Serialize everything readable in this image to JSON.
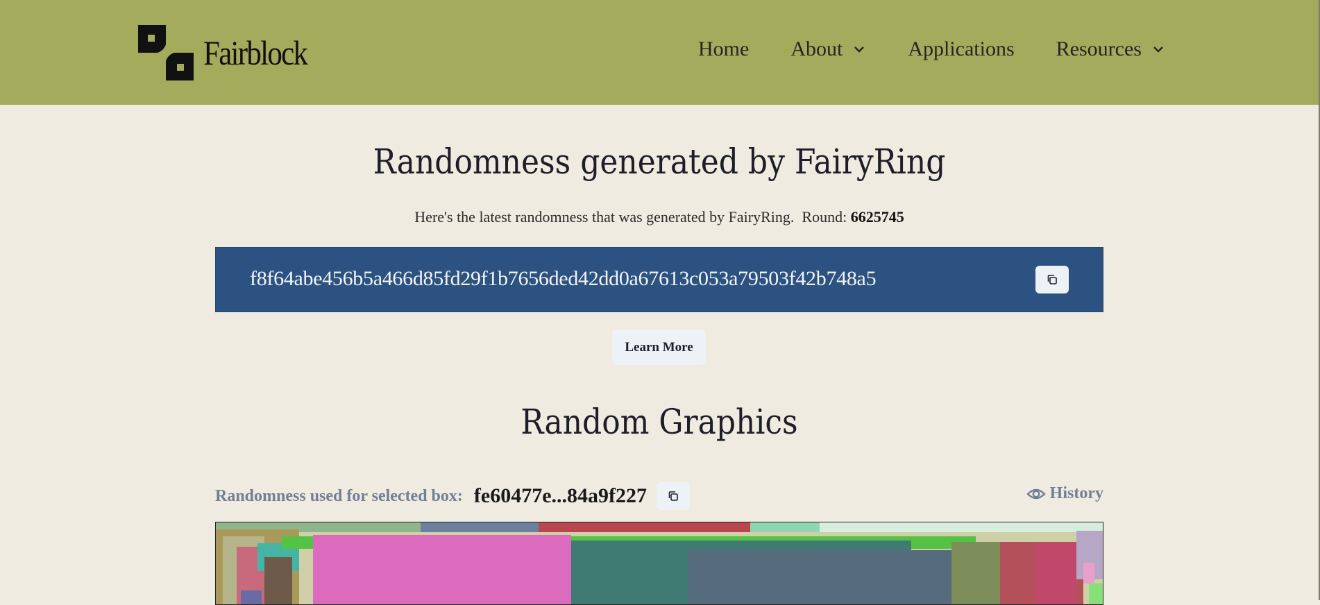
{
  "header": {
    "brand": "Fairblock",
    "nav": {
      "home": "Home",
      "about": "About",
      "applications": "Applications",
      "resources": "Resources"
    }
  },
  "hero": {
    "title": "Randomness generated by FairyRing",
    "subtitle": "Here's the latest randomness that was generated by FairyRing.",
    "round_label": "Round:",
    "round_value": "6625745",
    "randomness": "f8f64abe456b5a466d85fd29f1b7656ded42dd0a67613c053a79503f42b748a5",
    "learn_more": "Learn More"
  },
  "graphics": {
    "title": "Random Graphics",
    "selected_label": "Randomness used for selected box:",
    "selected_value": "fe60477e...84a9f227",
    "history_label": "History"
  },
  "colors": {
    "header_bg": "#a5ab5c",
    "page_bg": "#f0ebe0",
    "randomness_box_bg": "#2c5282",
    "button_bg": "#edf2f7",
    "muted_text": "#718096"
  },
  "icons": {
    "copy": "copy-icon",
    "history": "eye-icon",
    "dropdown": "chevron-down-icon"
  }
}
